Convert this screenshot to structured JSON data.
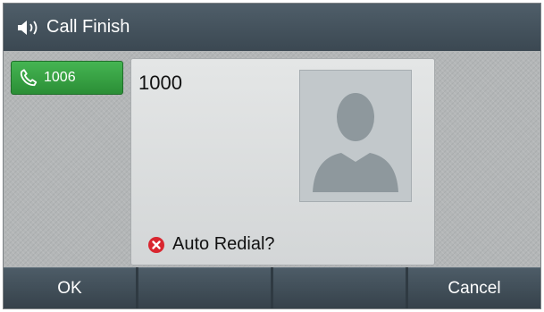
{
  "header": {
    "title": "Call Finish",
    "icon": "speaker-icon"
  },
  "line_key": {
    "label": "1006",
    "icon": "handset-icon",
    "color": "#3aa647"
  },
  "call": {
    "number": "1000",
    "avatar_icon": "contact-silhouette-icon",
    "status_icon": "error-x-icon",
    "status_text": "Auto Redial?"
  },
  "softkeys": [
    "OK",
    "",
    "",
    "Cancel"
  ]
}
